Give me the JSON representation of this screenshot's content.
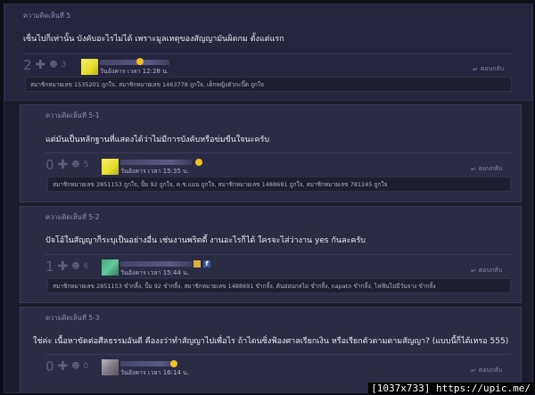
{
  "comments": [
    {
      "header": "ความคิดเห็นที่ 5",
      "body": "เซ็นไปก็เท่านั้น บังคับอะไรไม่ได้ เพราะมูลเหตุของสัญญามันผิดกม ตั้งแต่แรก",
      "votes": "2",
      "emotion_count": "3",
      "time": "วันอังคาร เวลา 12:28 น.",
      "reply_label": "ตอบกลับ",
      "likes": "สมาชิกหมายเลข 1535201 ถูกใจ, สมาชิกหมายเลข 1463778 ถูกใจ, เด็กหญิงตัวกะปิ๊ด ถูกใจ"
    },
    {
      "header": "ความคิดเห็นที่ 5-1",
      "body": "แต่มันเป็นหลักฐานที่แสดงได้ว่าไม่มีการบังคับหรือข่มขืนใจนะครับ",
      "votes": "0",
      "emotion_count": "5",
      "time": "วันอังคาร เวลา 15:35 น.",
      "reply_label": "ตอบกลับ",
      "likes": "สมาชิกหมายเลข 2851153 ถูกใจ, ปั้ม 92 ถูกใจ, ค.ช.แมน ถูกใจ, สมาชิกหมายเลข 1488691 ถูกใจ, สมาชิกหมายเลข 781245 ถูกใจ"
    },
    {
      "header": "ความคิดเห็นที่ 5-2",
      "body": "ปัจโอ้ในสัญญาก็ระบุเป็นอย่างอื่น เช่นงานพริตตี้ งานอะไรก็ได้ ใครจะไส่ว่างาน yes กันละครับ",
      "votes": "1",
      "emotion_count": "6",
      "time": "วันอังคาร เวลา 15:44 น.",
      "reply_label": "ตอบกลับ",
      "likes": "สมาชิกหมายเลข 2851153 ขำกลิ้ง, ปั้ม 92 ขำกลิ้ง, สมาชิกหมายเลข 1488691 ขำกลิ้ง, ต้นอ่อนกลไม่ ขำกลิ้ง, napatn ขำกลิ้ง, ไฟฟ้นไม่มีวันจาง ขำกลิ้ง"
    },
    {
      "header": "ความคิดเห็นที่ 5-3",
      "body": "ใช่ค่ะ เนื้อหาขัดต่อศีลธรรมอันดี คืองงว่าทำสัญญาไปเพื่อไร ถ้าไดนซิ่งฟ้องศาลเรียกเงิน หรือเรียกตัวตามตามสัญญา? (แบบนี้ก็ได้เหรอ 555)",
      "votes": "0",
      "emotion_count": "0",
      "time": "วันอังคาร เวลา 16:14 น.",
      "reply_label": "ตอบกลับ",
      "likes": ""
    }
  ],
  "watermark": "[1037x733] https://upic.me/",
  "colors": {
    "background": "#1c1c2d",
    "card": "#2b2b46",
    "header_text": "#8e8eb8"
  },
  "icons": [
    "plus-icon",
    "emotion-icon",
    "smiley-icon",
    "reply-arrow-icon",
    "facebook-icon",
    "medal-icon"
  ]
}
